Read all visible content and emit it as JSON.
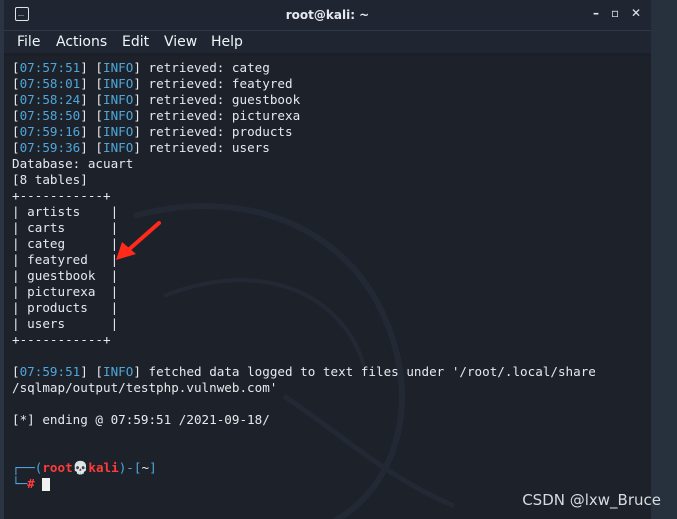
{
  "window": {
    "title": "root@kali: ~",
    "controls": [
      "–",
      "▫",
      "✕"
    ]
  },
  "menu": [
    "File",
    "Actions",
    "Edit",
    "View",
    "Help"
  ],
  "log_lines": [
    {
      "time": "07:57:51",
      "level": "INFO",
      "msg": "retrieved: categ"
    },
    {
      "time": "07:58:01",
      "level": "INFO",
      "msg": "retrieved: featyred"
    },
    {
      "time": "07:58:24",
      "level": "INFO",
      "msg": "retrieved: guestbook"
    },
    {
      "time": "07:58:50",
      "level": "INFO",
      "msg": "retrieved: picturexa"
    },
    {
      "time": "07:59:16",
      "level": "INFO",
      "msg": "retrieved: products"
    },
    {
      "time": "07:59:36",
      "level": "INFO",
      "msg": "retrieved: users"
    }
  ],
  "database_line": "Database: acuart",
  "table_count_line": "[8 tables]",
  "table_border": "+-----------+",
  "tables": [
    "artists",
    "carts",
    "categ",
    "featyred",
    "guestbook",
    "picturexa",
    "products",
    "users"
  ],
  "fetched": {
    "time": "07:59:51",
    "level": "INFO",
    "msg": "fetched data logged to text files under '/root/.local/share",
    "msg2": "/sqlmap/output/testphp.vulnweb.com'"
  },
  "ending_line": "[*] ending @ 07:59:51 /2021-09-18/",
  "prompt": {
    "user": "root",
    "skull": "💀",
    "host": "kali",
    "dir": "~",
    "symbol": "#"
  },
  "watermark": "CSDN @lxw_Bruce"
}
